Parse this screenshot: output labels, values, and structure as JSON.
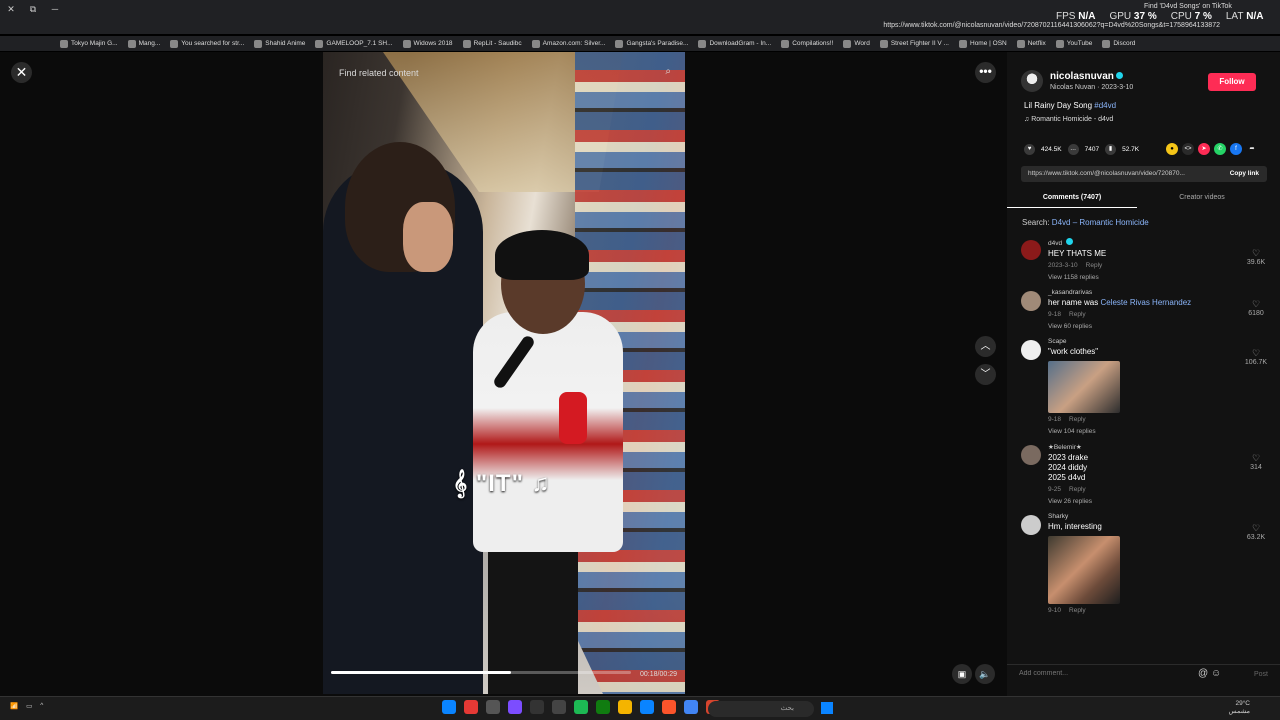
{
  "browser": {
    "tab_title": "Find 'D4vd Songs' on TikTok",
    "url": "https://www.tiktok.com/@nicolasnuvan/video/7208702116441306062?q=D4vd%20Songs&t=1758964133872",
    "bookmarks": [
      "Tokyo Majin G...",
      "Mang...",
      "You searched for str...",
      "Shahid Anime",
      "GAMELOOP_7.1 SH...",
      "Widows 2018",
      "RepLit - Saudibc",
      "Amazon.com: Silver...",
      "Gangsta's Paradise...",
      "DownloadGram - In...",
      "Compilations!!",
      "Word",
      "Street Fighter II V ...",
      "Home | OSN",
      "Netflix",
      "YouTube",
      "Discord"
    ]
  },
  "overlay": {
    "fps_label": "FPS",
    "fps_value": "N/A",
    "gpu_label": "GPU",
    "gpu_value": "37 %",
    "cpu_label": "CPU",
    "cpu_value": "7 %",
    "lat_label": "LAT",
    "lat_value": "N/A"
  },
  "video": {
    "find_related": "Find related content",
    "caption": "\"IT\"",
    "time": "00:18/00:29",
    "progress": 0.6
  },
  "panel": {
    "username": "nicolasnuvan",
    "display_name": "Nicolas Nuvan · 2023-3-10",
    "follow_label": "Follow",
    "description_text": "Lil Rainy Day Song ",
    "description_tag": "#d4vd",
    "music": "Romantic Homicide - d4vd",
    "likes": "424.5K",
    "comments_count": "7407",
    "saves": "52.7K",
    "link": "https://www.tiktok.com/@nicolasnuvan/video/720870...",
    "copy_link": "Copy link",
    "tab_comments": "Comments (7407)",
    "tab_creator": "Creator videos",
    "search_prefix": "Search: ",
    "search_term": "D4vd – Romantic Homicide"
  },
  "comments": [
    {
      "user": "d4vd",
      "text": "HEY THATS ME",
      "date": "2023-3-10",
      "reply": "Reply",
      "replies": "View 1158 replies",
      "likes": "39.6K"
    },
    {
      "user": "_kasandrarivas",
      "text_prefix": "her name was ",
      "text_highlight": "Celeste Rivas Hernandez",
      "date": "9-18",
      "reply": "Reply",
      "replies": "View 60 replies",
      "likes": "6180"
    },
    {
      "user": "Scape",
      "text": "\"work clothes\"",
      "date": "9-18",
      "reply": "Reply",
      "replies": "View 104 replies",
      "likes": "106.7K"
    },
    {
      "user": "★Belemir★",
      "text1": "2023 drake",
      "text2": "2024 diddy",
      "text3": "2025 d4vd",
      "date": "9-25",
      "reply": "Reply",
      "replies": "View 26 replies",
      "likes": "314"
    },
    {
      "user": "Sharky",
      "text": "Hm, interesting",
      "date": "9-10",
      "reply": "Reply",
      "likes": "63.2K"
    }
  ],
  "comment_bar": {
    "placeholder": "Add comment...",
    "post": "Post"
  },
  "taskbar": {
    "search": "بحث",
    "weather": "29°C",
    "weather_sub": "مشمس"
  },
  "colors": {
    "accent": "#fe2c55",
    "link": "#8ab4f8",
    "verified": "#20d5ec"
  }
}
